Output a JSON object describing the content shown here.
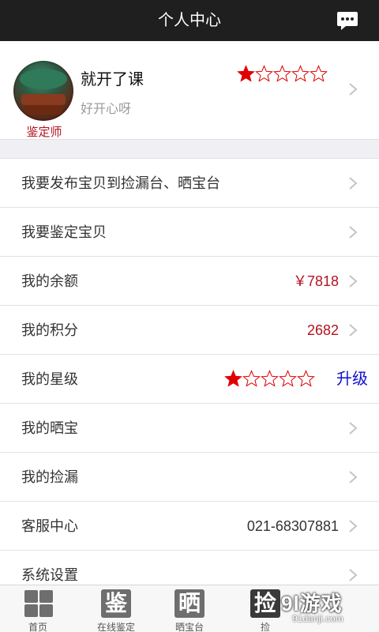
{
  "header": {
    "title": "个人中心",
    "message_icon": "chat-bubble-icon"
  },
  "profile": {
    "nickname": "就开了课",
    "signature": "好开心呀",
    "role": "鉴定师",
    "rating": 1,
    "rating_max": 5
  },
  "menu": {
    "publish": {
      "label": "我要发布宝贝到捡漏台、晒宝台"
    },
    "appraise": {
      "label": "我要鉴定宝贝"
    },
    "balance": {
      "label": "我的余额",
      "value": "￥7818"
    },
    "points": {
      "label": "我的积分",
      "value": "2682"
    },
    "level": {
      "label": "我的星级",
      "rating": 1,
      "rating_max": 5,
      "upgrade": "升级"
    },
    "showcase": {
      "label": "我的晒宝"
    },
    "bargain": {
      "label": "我的捡漏"
    },
    "service": {
      "label": "客服中心",
      "value": "021-68307881"
    },
    "settings": {
      "label": "系统设置"
    }
  },
  "tabbar": {
    "home": {
      "label": "首页",
      "icon": "grid-icon"
    },
    "online": {
      "label": "在线鉴定",
      "glyph": "鉴"
    },
    "show": {
      "label": "晒宝台",
      "glyph": "晒"
    },
    "pick": {
      "label": "捡",
      "glyph": "捡"
    }
  },
  "watermark": {
    "main": "9l游戏",
    "sub": "91danji.com"
  },
  "colors": {
    "topbar": "#1f1f1f",
    "accent_red": "#b3121f",
    "upgrade_blue": "#1010d0",
    "star": "#e00000"
  }
}
